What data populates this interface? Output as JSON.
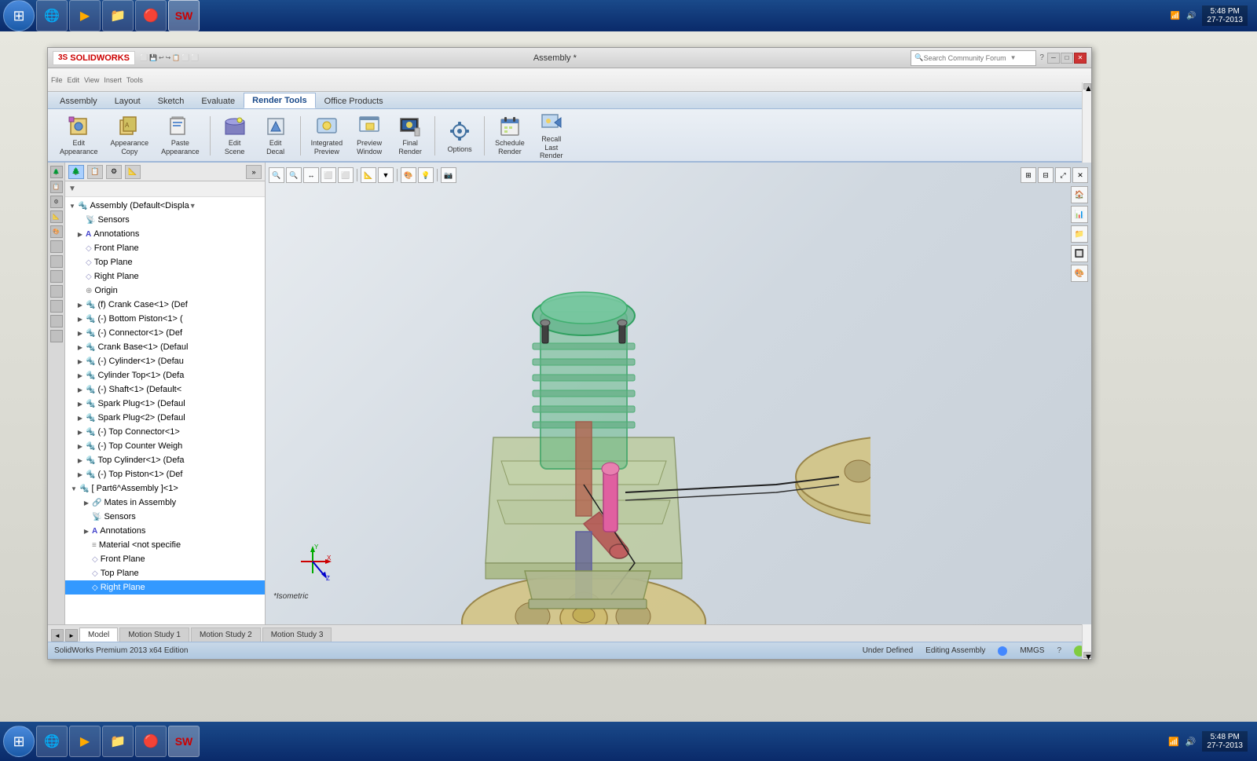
{
  "app": {
    "title": "Assembly *",
    "logo": "SOLIDWORKS",
    "version": "SolidWorks Premium 2013 x64 Edition",
    "search_placeholder": "Search Community Forum"
  },
  "top_taskbar": {
    "start_btn": "⊞",
    "items": [
      "IE",
      "WMP",
      "Explorer",
      "Chrome",
      "SW"
    ]
  },
  "ribbon": {
    "tabs": [
      "Assembly",
      "Layout",
      "Sketch",
      "Evaluate",
      "Render Tools",
      "Office Products"
    ],
    "active_tab": "Render Tools",
    "buttons": [
      {
        "id": "edit-appearance",
        "label": "Edit\nAppearance",
        "icon": "🎨"
      },
      {
        "id": "copy-appearance",
        "label": "Appearance\nCopy",
        "icon": "📋"
      },
      {
        "id": "paste-appearance",
        "label": "Paste\nAppearance",
        "icon": "📌"
      },
      {
        "id": "edit-scene",
        "label": "Edit\nScene",
        "icon": "🌄"
      },
      {
        "id": "edit-decal",
        "label": "Edit\nDecal",
        "icon": "🖼"
      },
      {
        "id": "integrated-preview",
        "label": "Integrated\nPreview",
        "icon": "👁"
      },
      {
        "id": "preview-window",
        "label": "Preview\nWindow",
        "icon": "🔲"
      },
      {
        "id": "final-render",
        "label": "Final\nRender",
        "icon": "🖥"
      },
      {
        "id": "options",
        "label": "Options",
        "icon": "⚙"
      },
      {
        "id": "schedule-render",
        "label": "Schedule\nRender",
        "icon": "📅"
      },
      {
        "id": "recall-last-render",
        "label": "Recall\nLast\nRender",
        "icon": "↩"
      }
    ]
  },
  "feature_tree": {
    "toolbar_icons": [
      "📁",
      "⊕",
      "🔍",
      "👁"
    ],
    "items": [
      {
        "id": "assembly-root",
        "label": "Assembly (Default<Displa",
        "level": 0,
        "toggle": "▼",
        "icon": "🔩"
      },
      {
        "id": "sensors",
        "label": "Sensors",
        "level": 1,
        "toggle": "",
        "icon": "📡"
      },
      {
        "id": "annotations",
        "label": "Annotations",
        "level": 1,
        "toggle": "▶",
        "icon": "A"
      },
      {
        "id": "front-plane",
        "label": "Front Plane",
        "level": 1,
        "toggle": "",
        "icon": "◇"
      },
      {
        "id": "top-plane",
        "label": "Top Plane",
        "level": 1,
        "toggle": "",
        "icon": "◇"
      },
      {
        "id": "right-plane",
        "label": "Right Plane",
        "level": 1,
        "toggle": "",
        "icon": "◇"
      },
      {
        "id": "origin",
        "label": "Origin",
        "level": 1,
        "toggle": "",
        "icon": "⊕"
      },
      {
        "id": "crank-case",
        "label": "(f) Crank Case<1> (Def",
        "level": 1,
        "toggle": "▶",
        "icon": "🔩"
      },
      {
        "id": "bottom-piston",
        "label": "(-) Bottom Piston<1> (",
        "level": 1,
        "toggle": "▶",
        "icon": "🔩"
      },
      {
        "id": "connector",
        "label": "(-) Connector<1> (Def",
        "level": 1,
        "toggle": "▶",
        "icon": "🔩"
      },
      {
        "id": "crank-base",
        "label": "Crank Base<1> (Defaul",
        "level": 1,
        "toggle": "▶",
        "icon": "🔩"
      },
      {
        "id": "cylinder",
        "label": "(-) Cylinder<1> (Defau",
        "level": 1,
        "toggle": "▶",
        "icon": "🔩"
      },
      {
        "id": "cylinder-top",
        "label": "Cylinder Top<1> (Defa",
        "level": 1,
        "toggle": "▶",
        "icon": "🔩"
      },
      {
        "id": "shaft",
        "label": "(-) Shaft<1> (Default<",
        "level": 1,
        "toggle": "▶",
        "icon": "🔩"
      },
      {
        "id": "spark-plug1",
        "label": "Spark Plug<1> (Defaul",
        "level": 1,
        "toggle": "▶",
        "icon": "🔩"
      },
      {
        "id": "spark-plug2",
        "label": "Spark Plug<2> (Defaul",
        "level": 1,
        "toggle": "▶",
        "icon": "🔩"
      },
      {
        "id": "top-connector",
        "label": "(-) Top Connector<1>",
        "level": 1,
        "toggle": "▶",
        "icon": "🔩"
      },
      {
        "id": "top-counter-weigh",
        "label": "(-) Top Counter Weigh",
        "level": 1,
        "toggle": "▶",
        "icon": "🔩"
      },
      {
        "id": "top-cylinder",
        "label": "Top Cylinder<1> (Defa",
        "level": 1,
        "toggle": "▶",
        "icon": "🔩"
      },
      {
        "id": "top-piston",
        "label": "(-) Top Piston<1> (Def",
        "level": 1,
        "toggle": "▶",
        "icon": "🔩"
      },
      {
        "id": "part6-assembly",
        "label": "[ Part6^Assembly ]<1>",
        "level": 1,
        "toggle": "▼",
        "icon": "🔩",
        "selected": false
      },
      {
        "id": "mates-in-assembly",
        "label": "Mates in Assembly",
        "level": 2,
        "toggle": "▶",
        "icon": "🔗"
      },
      {
        "id": "sensors2",
        "label": "Sensors",
        "level": 2,
        "toggle": "",
        "icon": "📡"
      },
      {
        "id": "annotations2",
        "label": "Annotations",
        "level": 2,
        "toggle": "▶",
        "icon": "A"
      },
      {
        "id": "material",
        "label": "Material <not specifie",
        "level": 2,
        "toggle": "",
        "icon": "≡"
      },
      {
        "id": "front-plane2",
        "label": "Front Plane",
        "level": 2,
        "toggle": "",
        "icon": "◇"
      },
      {
        "id": "top-plane2",
        "label": "Top Plane",
        "level": 2,
        "toggle": "",
        "icon": "◇"
      },
      {
        "id": "right-plane2",
        "label": "Right Plane",
        "level": 2,
        "toggle": "",
        "icon": "◇",
        "selected": true
      }
    ]
  },
  "viewport": {
    "label": "*Isometric",
    "toolbar_icons": [
      "🔍+",
      "🔍-",
      "↔",
      "⬜",
      "⬜",
      "📐",
      "🎨",
      "💡",
      "📷"
    ]
  },
  "bottom_tabs": {
    "nav": [
      "◄",
      "►"
    ],
    "tabs": [
      "Model",
      "Motion Study 1",
      "Motion Study 2",
      "Motion Study 3"
    ],
    "active": "Model"
  },
  "status_bar": {
    "left": "SolidWorks Premium 2013 x64 Edition",
    "status": "Under Defined",
    "mode": "Editing Assembly",
    "units": "MMGS",
    "help": "?"
  },
  "taskbar": {
    "time": "5:48 PM",
    "date": "27-7-2013",
    "apps": [
      "⊞",
      "🌐",
      "▶",
      "📁",
      "🔴",
      "SW"
    ]
  }
}
